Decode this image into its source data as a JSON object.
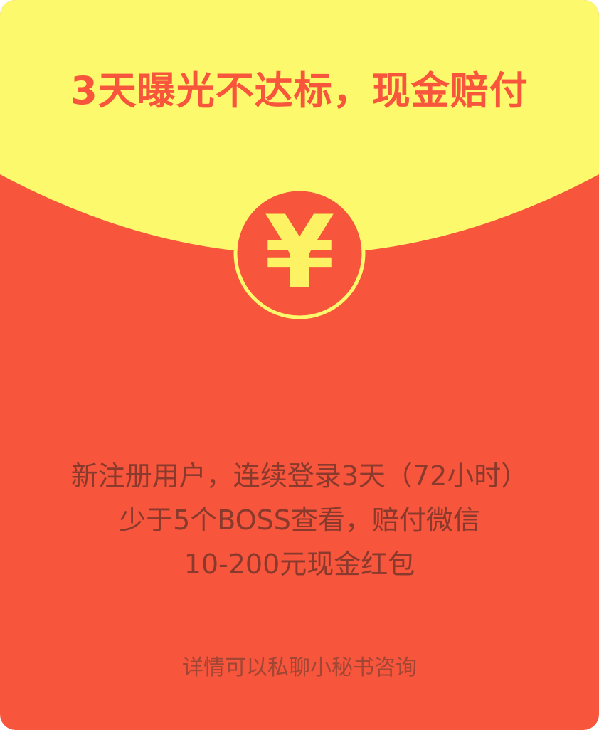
{
  "colors": {
    "card_red": "#f7553c",
    "flap_yellow": "#fcf96c",
    "coin_yellow": "#fcf264",
    "body_text": "#8a3a2c",
    "footnote_text": "#a14634"
  },
  "headline": "3天曝光不达标，现金赔付",
  "coin": {
    "icon": "yuan-icon",
    "symbol": "¥"
  },
  "description": {
    "line1": "新注册用户，连续登录3天（72小时）",
    "line2": "少于5个BOSS查看，赔付微信",
    "line3": "10-200元现金红包"
  },
  "footnote": "详情可以私聊小秘书咨询"
}
